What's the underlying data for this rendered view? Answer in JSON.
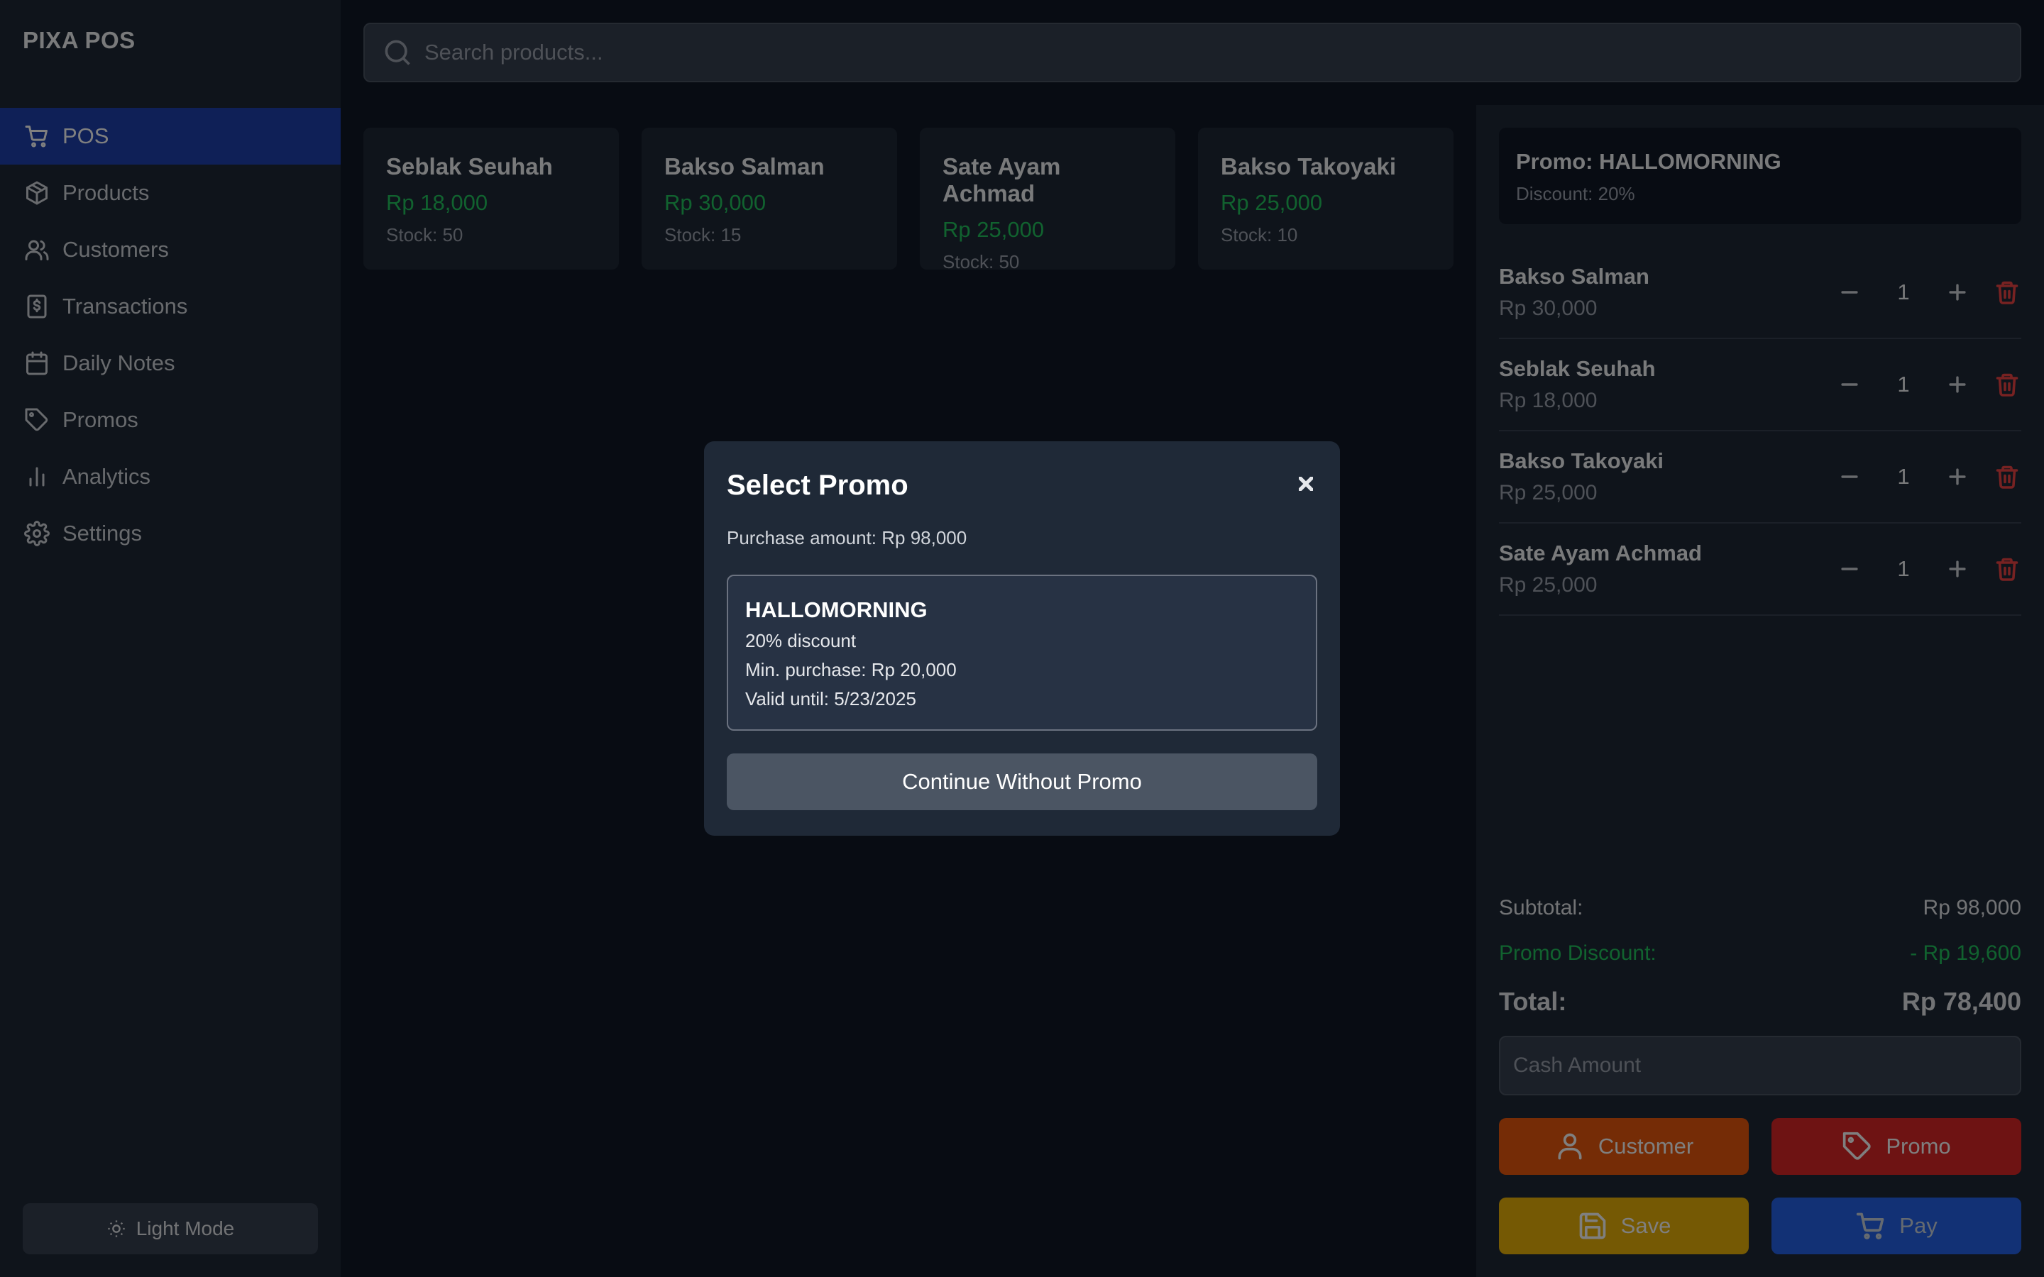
{
  "app": {
    "brand": "PIXA POS"
  },
  "sidebar": {
    "items": [
      {
        "label": "POS",
        "icon": "cart-icon",
        "active": true
      },
      {
        "label": "Products",
        "icon": "package-icon"
      },
      {
        "label": "Customers",
        "icon": "users-icon"
      },
      {
        "label": "Transactions",
        "icon": "receipt-icon"
      },
      {
        "label": "Daily Notes",
        "icon": "calendar-icon"
      },
      {
        "label": "Promos",
        "icon": "tag-icon"
      },
      {
        "label": "Analytics",
        "icon": "bar-chart-icon"
      },
      {
        "label": "Settings",
        "icon": "gear-icon"
      }
    ],
    "theme_toggle": "Light Mode"
  },
  "search": {
    "placeholder": "Search products..."
  },
  "products": [
    {
      "name": "Seblak Seuhah",
      "price": "Rp 18,000",
      "stock": "Stock: 50"
    },
    {
      "name": "Bakso Salman",
      "price": "Rp 30,000",
      "stock": "Stock: 15"
    },
    {
      "name": "Sate Ayam Achmad",
      "price": "Rp 25,000",
      "stock": "Stock: 50"
    },
    {
      "name": "Bakso Takoyaki",
      "price": "Rp 25,000",
      "stock": "Stock: 10"
    }
  ],
  "cart": {
    "promo": {
      "title": "Promo: HALLOMORNING",
      "discount": "Discount: 20%"
    },
    "items": [
      {
        "name": "Bakso Salman",
        "price": "Rp 30,000",
        "qty": "1"
      },
      {
        "name": "Seblak Seuhah",
        "price": "Rp 18,000",
        "qty": "1"
      },
      {
        "name": "Bakso Takoyaki",
        "price": "Rp 25,000",
        "qty": "1"
      },
      {
        "name": "Sate Ayam Achmad",
        "price": "Rp 25,000",
        "qty": "1"
      }
    ],
    "subtotal_label": "Subtotal:",
    "subtotal_value": "Rp 98,000",
    "discount_label": "Promo Discount:",
    "discount_value": "- Rp 19,600",
    "total_label": "Total:",
    "total_value": "Rp 78,400",
    "cash_placeholder": "Cash Amount",
    "buttons": {
      "customer": "Customer",
      "promo": "Promo",
      "save": "Save",
      "pay": "Pay"
    }
  },
  "modal": {
    "title": "Select Promo",
    "purchase_amount": "Purchase amount: Rp 98,000",
    "promos": [
      {
        "code": "HALLOMORNING",
        "discount": "20% discount",
        "min_purchase": "Min. purchase: Rp 20,000",
        "valid_until": "Valid until: 5/23/2025"
      }
    ],
    "continue_label": "Continue Without Promo"
  },
  "colors": {
    "sidebar_bg": "#1f2937",
    "active_nav": "#1e40af",
    "price_green": "#22c55e",
    "delete_red": "#ef4444",
    "customer_orange": "#ea580c",
    "promo_red": "#dc2626",
    "save_yellow": "#eab308",
    "pay_blue": "#2563eb"
  }
}
